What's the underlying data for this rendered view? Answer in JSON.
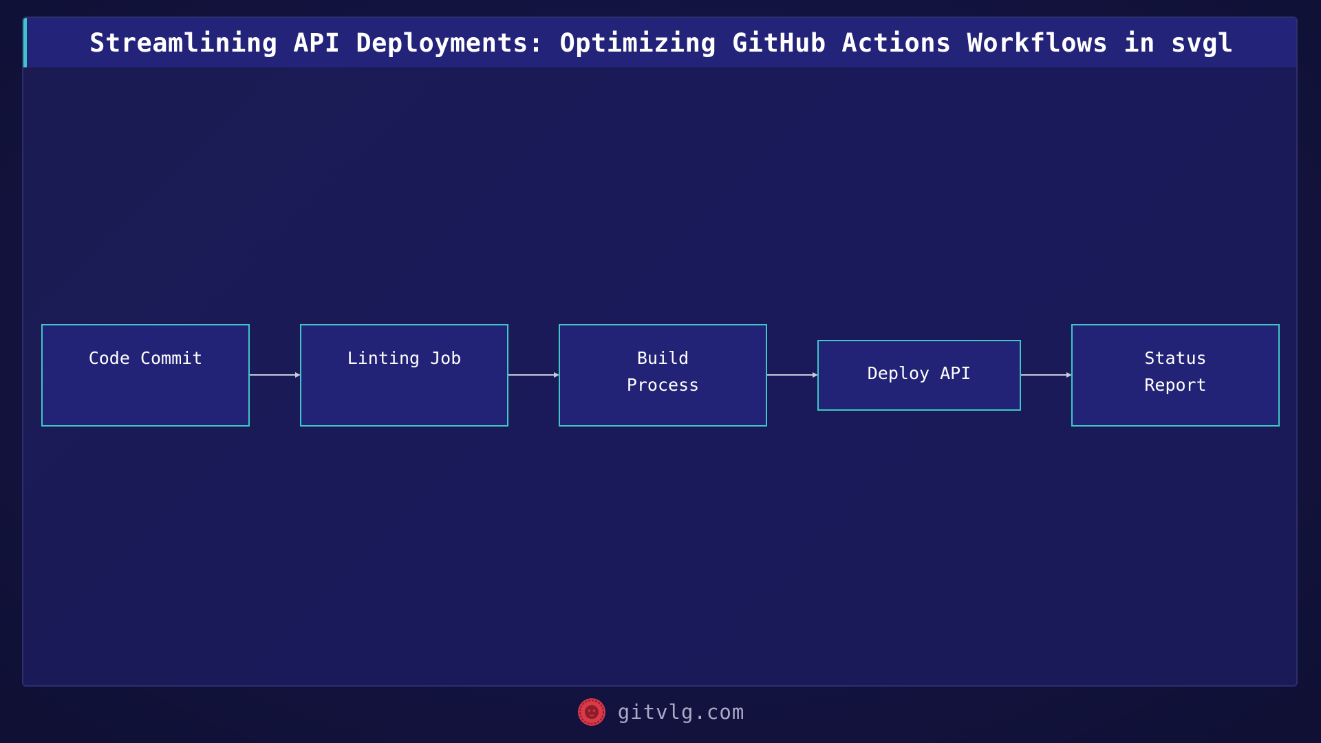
{
  "title": "Streamlining API Deployments: Optimizing GitHub Actions Workflows in svgl",
  "nodes": [
    {
      "id": "code-commit",
      "lines": [
        "Code Commit"
      ]
    },
    {
      "id": "linting-job",
      "lines": [
        "Linting Job"
      ]
    },
    {
      "id": "build-process",
      "lines": [
        "Build",
        "Process"
      ]
    },
    {
      "id": "deploy-api",
      "lines": [
        "Deploy API"
      ]
    },
    {
      "id": "status-report",
      "lines": [
        "Status",
        "Report"
      ]
    }
  ],
  "edges": [
    {
      "from": "code-commit",
      "to": "linting-job"
    },
    {
      "from": "linting-job",
      "to": "build-process"
    },
    {
      "from": "build-process",
      "to": "deploy-api"
    },
    {
      "from": "deploy-api",
      "to": "status-report"
    }
  ],
  "footer": {
    "site": "gitvlg.com",
    "logo_icon": "lion-logo-icon"
  },
  "colors": {
    "background": "#131340",
    "title_bar": "#24237a",
    "accent": "#3fc7c7",
    "node_fill": "#222276",
    "edge": "#c9c9e0",
    "logo": "#d9394a"
  }
}
